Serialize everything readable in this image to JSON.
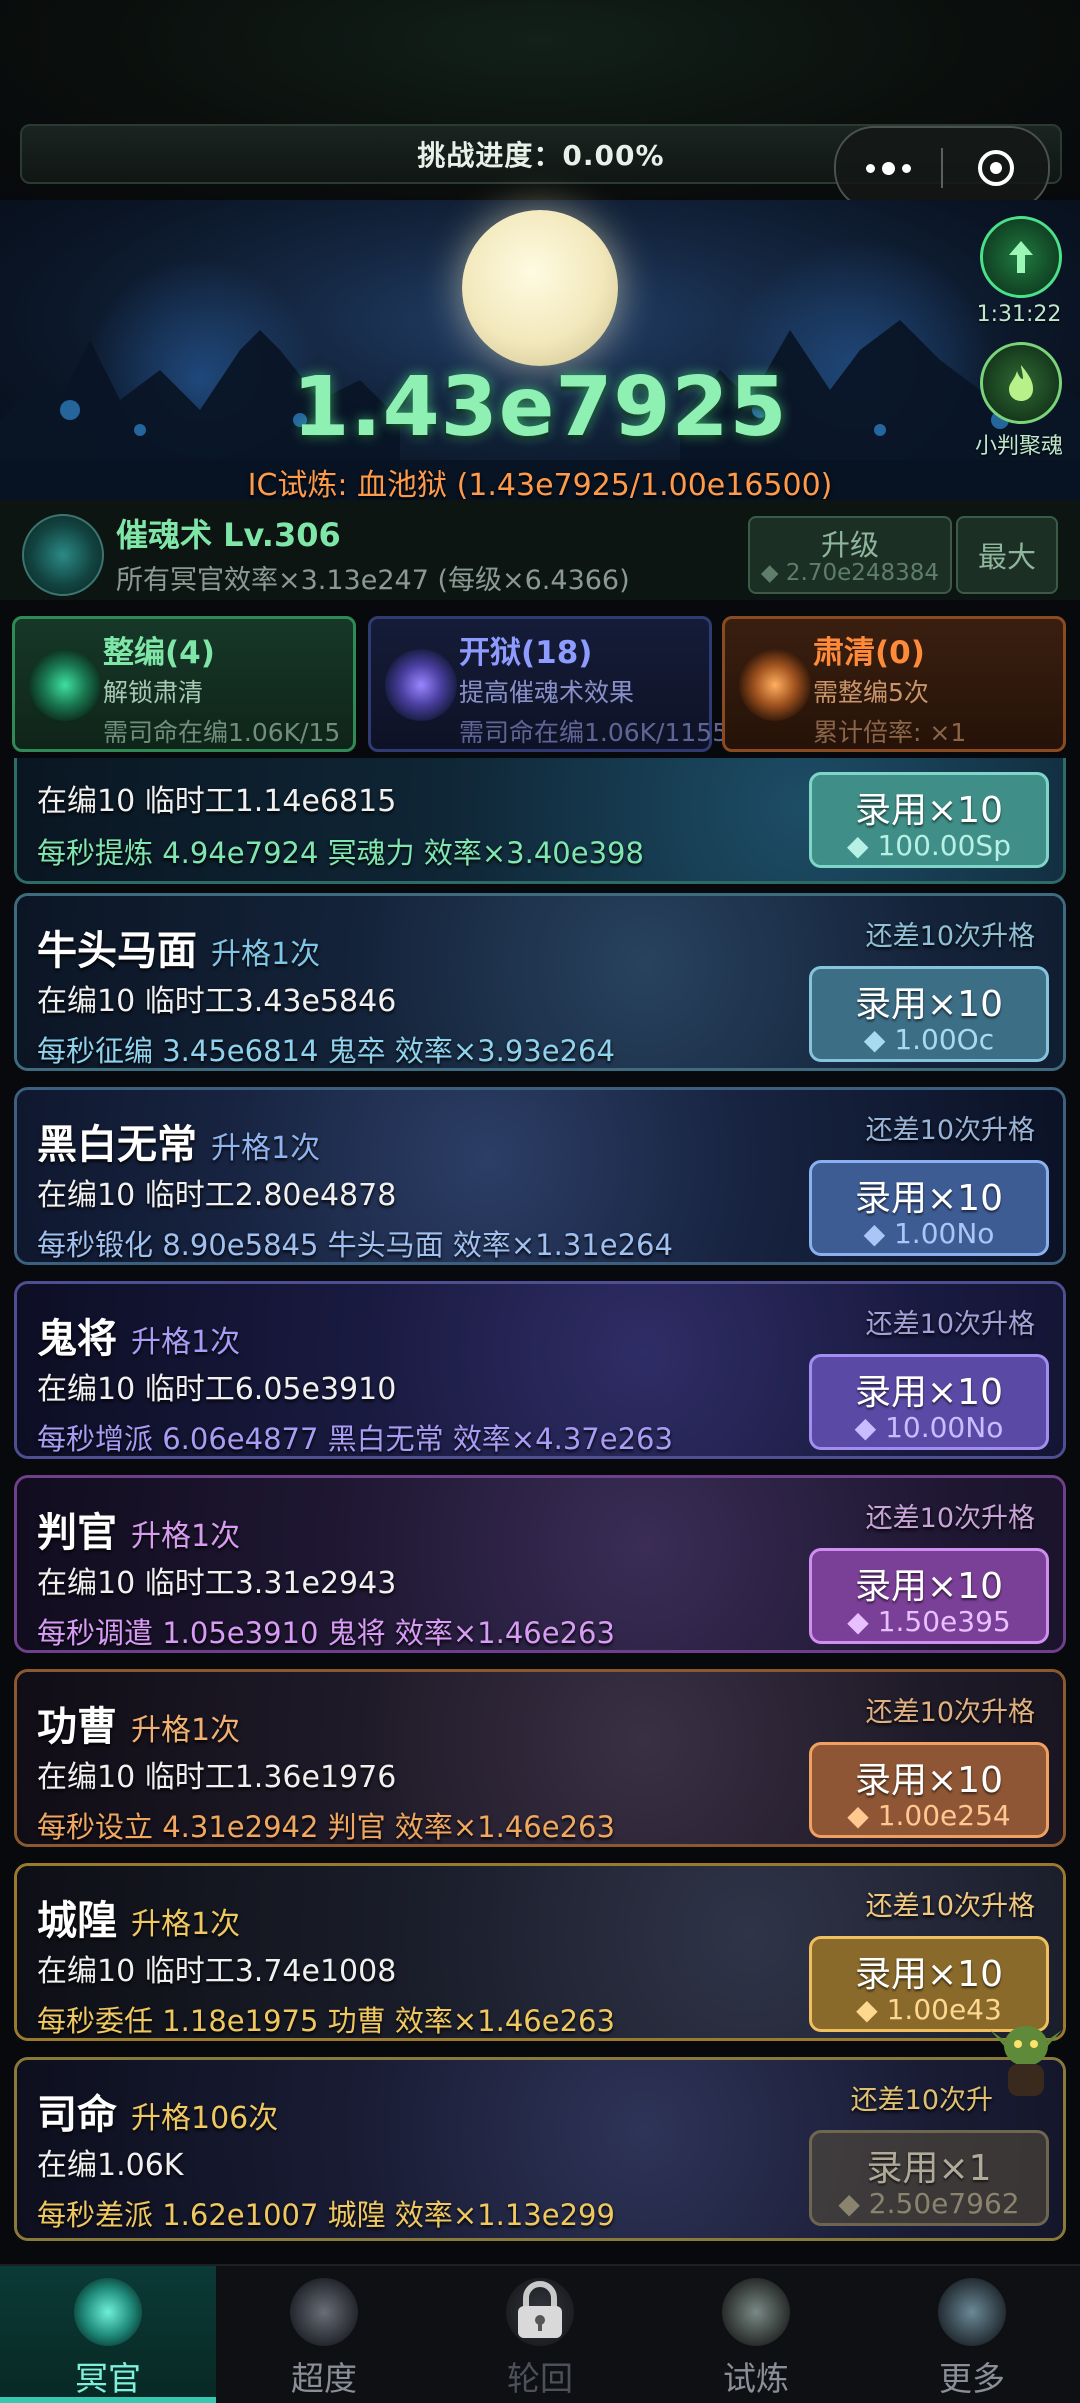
{
  "challenge": {
    "label": "挑战进度：0.00%"
  },
  "hero": {
    "value": "1.43e7925",
    "trial": "IC试炼: 血池狱 (1.43e7925/1.00e16500)",
    "timer": "1:31:22",
    "gather_label": "小判聚魂"
  },
  "skill": {
    "name": "催魂术 Lv.306",
    "desc": "所有冥官效率×3.13e247 (每级×6.4366)",
    "upgrade_label": "升级",
    "upgrade_cost": "◆ 2.70e248384",
    "max_label": "最大"
  },
  "categories": [
    {
      "title": "整编(4)",
      "line1": "解锁肃清",
      "line2": "需司命在编1.06K/15"
    },
    {
      "title": "开狱(18)",
      "line1": "提高催魂术效果",
      "line2": "需司命在编1.06K/1155"
    },
    {
      "title": "肃清(0)",
      "line1": "需整编5次",
      "line2": "累计倍率: ×1"
    }
  ],
  "units": [
    {
      "name": "",
      "rank": "",
      "staff": "在编10  临时工1.14e6815",
      "rate": "每秒提炼 4.94e7924 冥魂力  效率×3.40e398",
      "remain": "",
      "hire": "录用×10",
      "cost": "◆ 100.00Sp"
    },
    {
      "name": "牛头马面",
      "rank": "升格1次",
      "staff": "在编10  临时工3.43e5846",
      "rate": "每秒征编 3.45e6814 鬼卒  效率×3.93e264",
      "remain": "还差10次升格",
      "hire": "录用×10",
      "cost": "◆ 1.00Oc"
    },
    {
      "name": "黑白无常",
      "rank": "升格1次",
      "staff": "在编10  临时工2.80e4878",
      "rate": "每秒锻化 8.90e5845 牛头马面  效率×1.31e264",
      "remain": "还差10次升格",
      "hire": "录用×10",
      "cost": "◆ 1.00No"
    },
    {
      "name": "鬼将",
      "rank": "升格1次",
      "staff": "在编10  临时工6.05e3910",
      "rate": "每秒增派 6.06e4877 黑白无常  效率×4.37e263",
      "remain": "还差10次升格",
      "hire": "录用×10",
      "cost": "◆ 10.00No"
    },
    {
      "name": "判官",
      "rank": "升格1次",
      "staff": "在编10  临时工3.31e2943",
      "rate": "每秒调遣 1.05e3910 鬼将  效率×1.46e263",
      "remain": "还差10次升格",
      "hire": "录用×10",
      "cost": "◆ 1.50e395"
    },
    {
      "name": "功曹",
      "rank": "升格1次",
      "staff": "在编10  临时工1.36e1976",
      "rate": "每秒设立 4.31e2942 判官  效率×1.46e263",
      "remain": "还差10次升格",
      "hire": "录用×10",
      "cost": "◆ 1.00e254"
    },
    {
      "name": "城隍",
      "rank": "升格1次",
      "staff": "在编10  临时工3.74e1008",
      "rate": "每秒委任 1.18e1975 功曹  效率×1.46e263",
      "remain": "还差10次升格",
      "hire": "录用×10",
      "cost": "◆ 1.00e43"
    },
    {
      "name": "司命",
      "rank": "升格106次",
      "staff": "在编1.06K",
      "rate": "每秒差派 1.62e1007 城隍  效率×1.13e299",
      "remain": "还差10次升",
      "hire": "录用×1",
      "cost": "◆ 2.50e7962"
    }
  ],
  "nav": [
    {
      "label": "冥官",
      "active": true
    },
    {
      "label": "超度",
      "active": false
    },
    {
      "label": "轮回",
      "active": false
    },
    {
      "label": "试炼",
      "active": false
    },
    {
      "label": "更多",
      "active": false
    }
  ]
}
